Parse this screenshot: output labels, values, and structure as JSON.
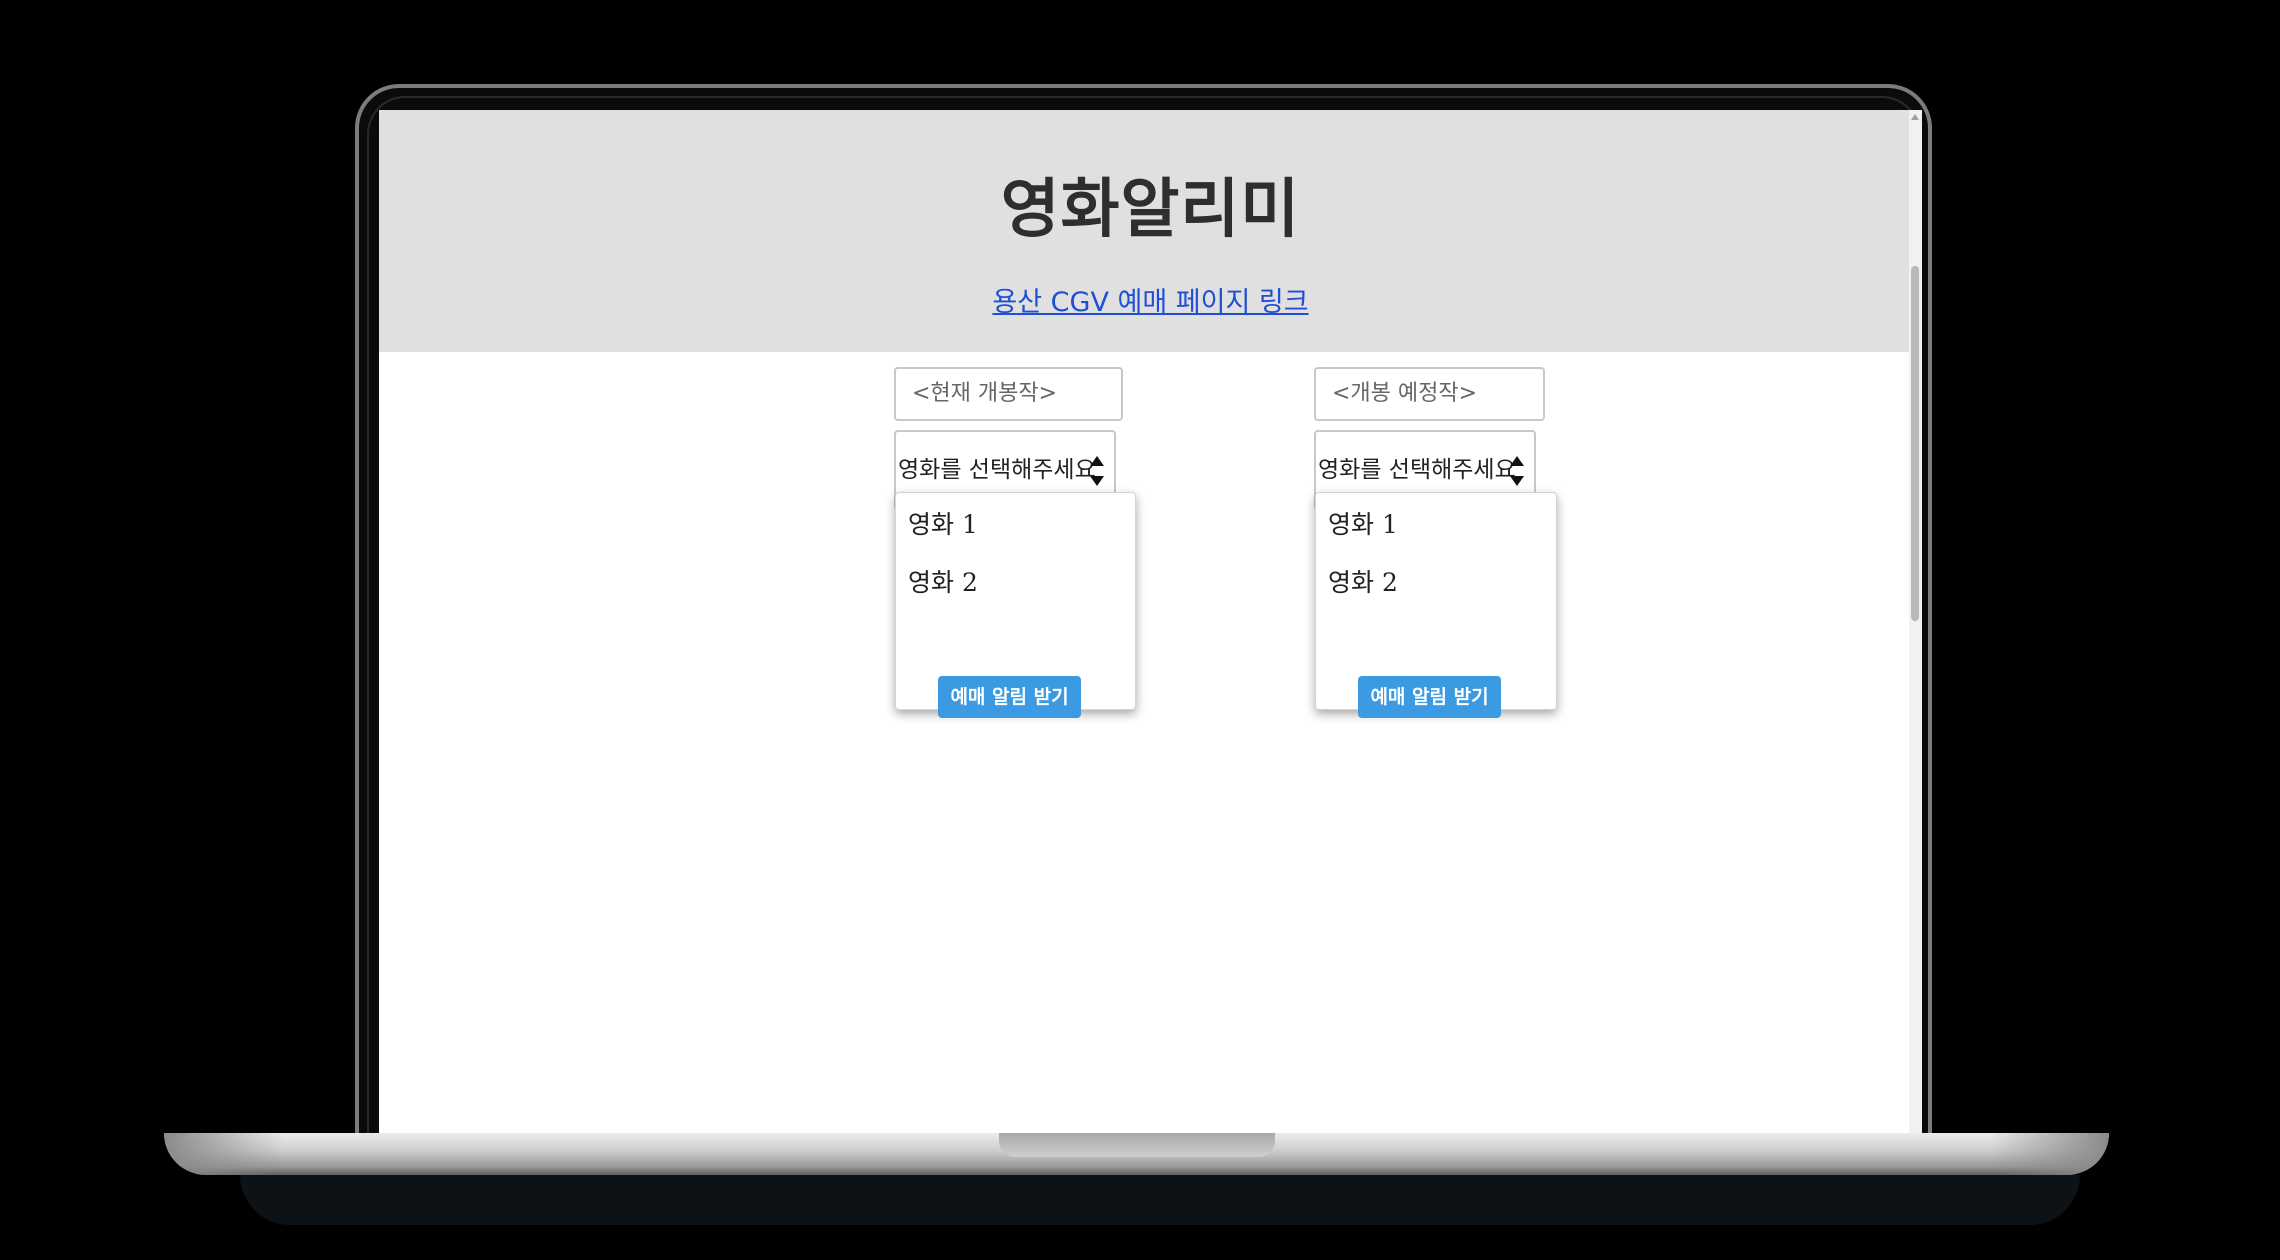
{
  "page": {
    "title": "영화알리미",
    "link_text": "용산 CGV 예매 페이지 링크"
  },
  "columns": [
    {
      "input_placeholder": "<현재 개봉작>",
      "select_value": "영화를 선택해주세요",
      "options": [
        "영화 1",
        "영화 2"
      ],
      "button_label": "예매 알림 받기"
    },
    {
      "input_placeholder": "<개봉 예정작>",
      "select_value": "영화를 선택해주세요",
      "options": [
        "영화 1",
        "영화 2"
      ],
      "button_label": "예매 알림 받기"
    }
  ],
  "colors": {
    "header_bg": "#e0e0e0",
    "link": "#1f4fd6",
    "button_bg": "#3b9ae1"
  }
}
